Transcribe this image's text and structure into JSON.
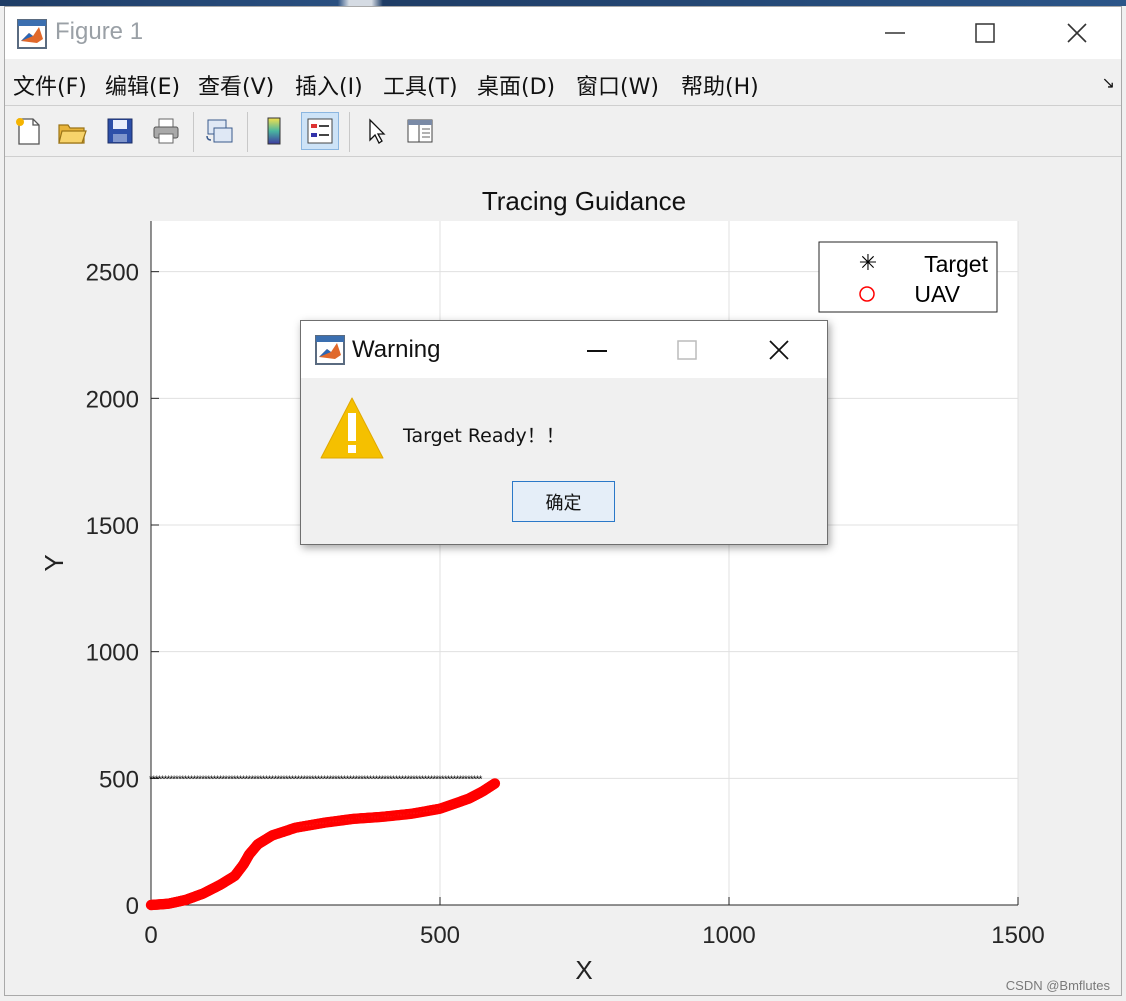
{
  "window": {
    "title": "Figure 1"
  },
  "menu": [
    "文件(F)",
    "编辑(E)",
    "查看(V)",
    "插入(I)",
    "工具(T)",
    "桌面(D)",
    "窗口(W)",
    "帮助(H)"
  ],
  "toolbar": [
    {
      "icon": "new-figure-icon"
    },
    {
      "icon": "open-file-icon"
    },
    {
      "icon": "save-icon"
    },
    {
      "icon": "print-icon"
    },
    {
      "icon": "link-plot-icon"
    },
    {
      "icon": "colorbar-icon"
    },
    {
      "icon": "legend-icon",
      "active": true
    },
    {
      "icon": "pointer-icon"
    },
    {
      "icon": "property-editor-icon"
    }
  ],
  "chart_data": {
    "type": "scatter",
    "title": "Tracing Guidance",
    "xlabel": "X",
    "ylabel": "Y",
    "xlim": [
      0,
      1500
    ],
    "ylim": [
      0,
      2700
    ],
    "xticks": [
      0,
      500,
      1000,
      1500
    ],
    "yticks": [
      0,
      500,
      1000,
      1500,
      2000,
      2500
    ],
    "grid": true,
    "legend_position": "top-right",
    "series": [
      {
        "name": "Target",
        "marker": "asterisk",
        "color": "#000000",
        "x_range": [
          0,
          570
        ],
        "y": 500
      },
      {
        "name": "UAV",
        "marker": "circle",
        "color": "#ff0000",
        "x": [
          0,
          30,
          60,
          90,
          120,
          145,
          160,
          170,
          185,
          210,
          250,
          300,
          350,
          400,
          450,
          500,
          550,
          575,
          595
        ],
        "y": [
          0,
          5,
          20,
          45,
          80,
          115,
          160,
          200,
          240,
          275,
          305,
          325,
          340,
          348,
          360,
          380,
          420,
          450,
          480
        ]
      }
    ]
  },
  "dialog": {
    "title": "Warning",
    "message": "Target Ready！！",
    "ok_label": "确定"
  },
  "watermark": "CSDN @Bmflutes"
}
